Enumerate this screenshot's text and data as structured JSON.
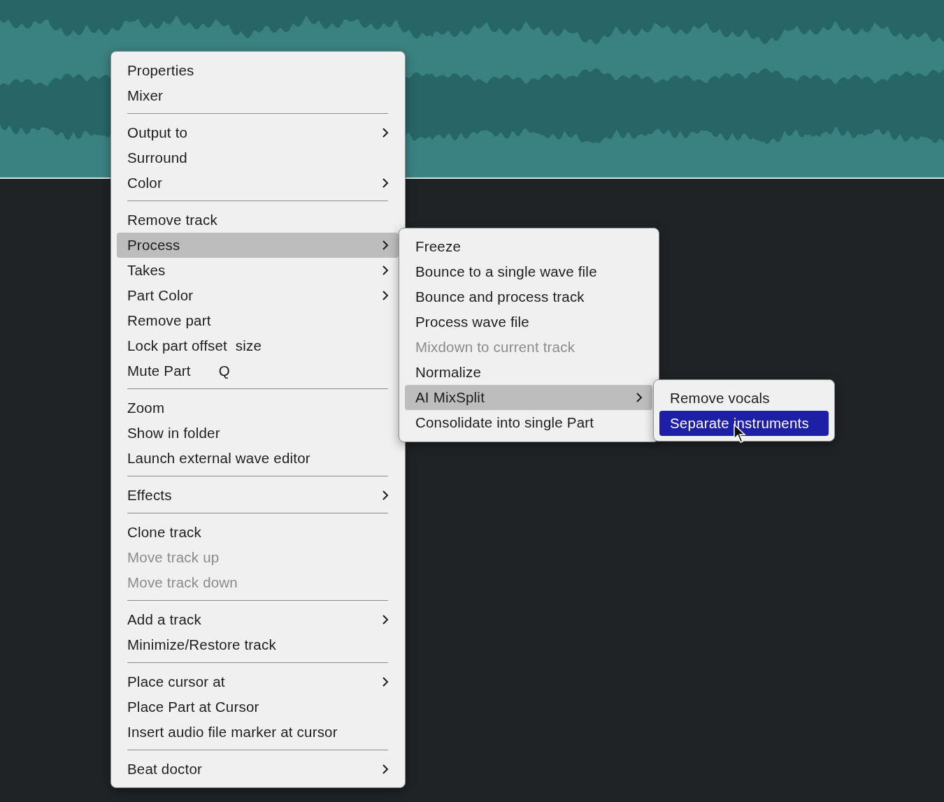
{
  "menu": {
    "items": [
      {
        "kind": "item",
        "label": "Properties",
        "selected": false,
        "disabled": false,
        "submenu": false
      },
      {
        "kind": "item",
        "label": "Mixer",
        "selected": false,
        "disabled": false,
        "submenu": false
      },
      {
        "kind": "separator"
      },
      {
        "kind": "item",
        "label": "Output to",
        "selected": false,
        "disabled": false,
        "submenu": true
      },
      {
        "kind": "item",
        "label": "Surround",
        "selected": false,
        "disabled": false,
        "submenu": false
      },
      {
        "kind": "item",
        "label": "Color",
        "selected": false,
        "disabled": false,
        "submenu": true
      },
      {
        "kind": "separator"
      },
      {
        "kind": "item",
        "label": "Remove track",
        "selected": false,
        "disabled": false,
        "submenu": false
      },
      {
        "kind": "item",
        "label": "Process",
        "selected": true,
        "disabled": false,
        "submenu": true
      },
      {
        "kind": "item",
        "label": "Takes",
        "selected": false,
        "disabled": false,
        "submenu": true
      },
      {
        "kind": "item",
        "label": "Part Color",
        "selected": false,
        "disabled": false,
        "submenu": true
      },
      {
        "kind": "item",
        "label": "Remove part",
        "selected": false,
        "disabled": false,
        "submenu": false
      },
      {
        "kind": "item",
        "label": "Lock part offset  size",
        "selected": false,
        "disabled": false,
        "submenu": false
      },
      {
        "kind": "item",
        "label": "Mute Part",
        "shortcut": "Q",
        "selected": false,
        "disabled": false,
        "submenu": false
      },
      {
        "kind": "separator"
      },
      {
        "kind": "item",
        "label": "Zoom",
        "selected": false,
        "disabled": false,
        "submenu": false
      },
      {
        "kind": "item",
        "label": "Show in folder",
        "selected": false,
        "disabled": false,
        "submenu": false
      },
      {
        "kind": "item",
        "label": "Launch external wave editor",
        "selected": false,
        "disabled": false,
        "submenu": false
      },
      {
        "kind": "separator"
      },
      {
        "kind": "item",
        "label": "Effects",
        "selected": false,
        "disabled": false,
        "submenu": true
      },
      {
        "kind": "separator"
      },
      {
        "kind": "item",
        "label": "Clone track",
        "selected": false,
        "disabled": false,
        "submenu": false
      },
      {
        "kind": "item",
        "label": "Move track up",
        "selected": false,
        "disabled": true,
        "submenu": false
      },
      {
        "kind": "item",
        "label": "Move track down",
        "selected": false,
        "disabled": true,
        "submenu": false
      },
      {
        "kind": "separator"
      },
      {
        "kind": "item",
        "label": "Add a track",
        "selected": false,
        "disabled": false,
        "submenu": true
      },
      {
        "kind": "item",
        "label": "Minimize/Restore track",
        "selected": false,
        "disabled": false,
        "submenu": false
      },
      {
        "kind": "separator"
      },
      {
        "kind": "item",
        "label": "Place cursor at",
        "selected": false,
        "disabled": false,
        "submenu": true
      },
      {
        "kind": "item",
        "label": "Place Part at Cursor",
        "selected": false,
        "disabled": false,
        "submenu": false
      },
      {
        "kind": "item",
        "label": "Insert audio file marker at cursor",
        "selected": false,
        "disabled": false,
        "submenu": false
      },
      {
        "kind": "separator"
      },
      {
        "kind": "item",
        "label": "Beat doctor",
        "selected": false,
        "disabled": false,
        "submenu": true
      }
    ]
  },
  "process_submenu": {
    "items": [
      {
        "kind": "item",
        "label": "Freeze",
        "selected": false,
        "disabled": false,
        "submenu": false
      },
      {
        "kind": "item",
        "label": "Bounce to a single wave file",
        "selected": false,
        "disabled": false,
        "submenu": false
      },
      {
        "kind": "item",
        "label": "Bounce and process track",
        "selected": false,
        "disabled": false,
        "submenu": false
      },
      {
        "kind": "item",
        "label": "Process wave file",
        "selected": false,
        "disabled": false,
        "submenu": false
      },
      {
        "kind": "item",
        "label": "Mixdown to current track",
        "selected": false,
        "disabled": true,
        "submenu": false
      },
      {
        "kind": "item",
        "label": "Normalize",
        "selected": false,
        "disabled": false,
        "submenu": false
      },
      {
        "kind": "item",
        "label": "AI MixSplit",
        "selected": true,
        "disabled": false,
        "submenu": true
      },
      {
        "kind": "item",
        "label": "Consolidate into single Part",
        "selected": false,
        "disabled": false,
        "submenu": false
      }
    ]
  },
  "mixsplit_submenu": {
    "items": [
      {
        "kind": "item",
        "label": "Remove vocals",
        "selected": false,
        "disabled": false,
        "submenu": false
      },
      {
        "kind": "item",
        "label": "Separate instruments",
        "selected": true,
        "disabled": false,
        "submenu": false
      }
    ]
  }
}
